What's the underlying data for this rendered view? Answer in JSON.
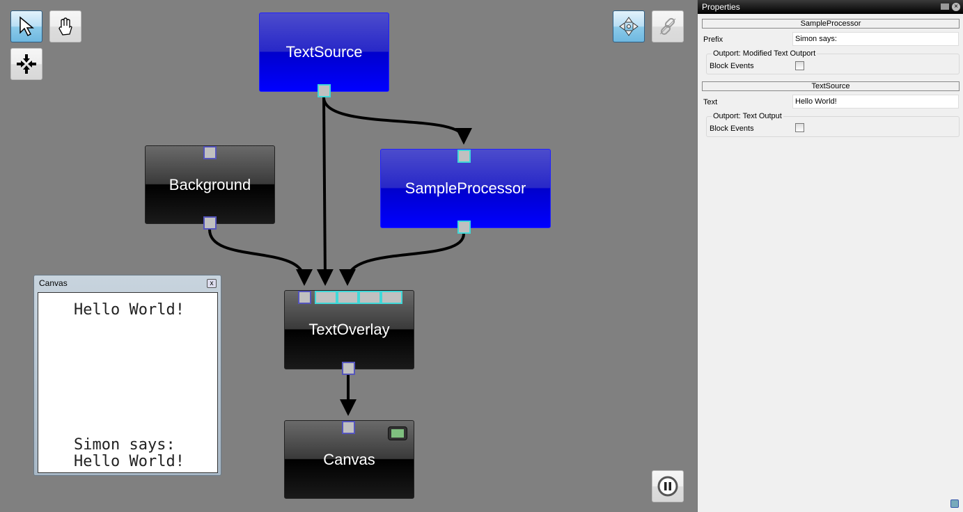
{
  "toolbar": {
    "select_icon": "arrow-cursor",
    "pan_icon": "hand",
    "fit_icon": "fit-to-view",
    "move_icon": "move-arrows",
    "link_icon": "chain-link",
    "pause_icon": "pause"
  },
  "nodes": {
    "text_source": "TextSource",
    "background": "Background",
    "sample_processor": "SampleProcessor",
    "text_overlay": "TextOverlay",
    "canvas": "Canvas"
  },
  "canvas_window": {
    "title": "Canvas",
    "close": "x",
    "line1": "Hello World!",
    "line2": "Simon says:",
    "line3": "Hello World!"
  },
  "properties": {
    "title": "Properties",
    "sample_processor": {
      "header": "SampleProcessor",
      "prefix_label": "Prefix",
      "prefix_value": "Simon says:",
      "outport_label": "Outport: Modified Text Outport",
      "block_events_label": "Block Events",
      "block_events": false
    },
    "text_source": {
      "header": "TextSource",
      "text_label": "Text",
      "text_value": "Hello World!",
      "outport_label": "Outport: Text Output",
      "block_events_label": "Block Events",
      "block_events": false
    }
  },
  "colors": {
    "processor_selected": "#0000ff",
    "port_inport": "#5555bb",
    "port_outport": "#40d8d8",
    "canvas_bg": "#808080"
  }
}
